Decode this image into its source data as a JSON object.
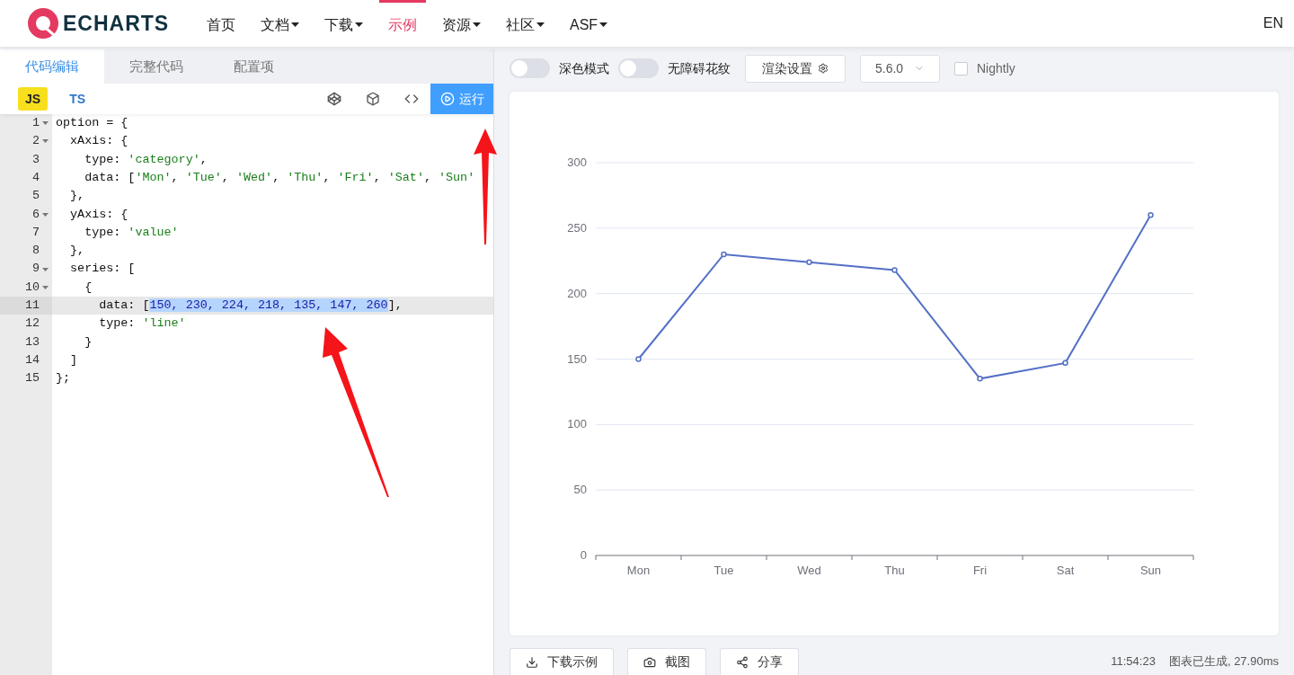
{
  "header": {
    "logo": "ECHARTS",
    "nav": [
      {
        "label": "首页",
        "dropdown": false,
        "selected": false
      },
      {
        "label": "文档",
        "dropdown": true,
        "selected": false
      },
      {
        "label": "下载",
        "dropdown": true,
        "selected": false
      },
      {
        "label": "示例",
        "dropdown": false,
        "selected": true
      },
      {
        "label": "资源",
        "dropdown": true,
        "selected": false
      },
      {
        "label": "社区",
        "dropdown": true,
        "selected": false
      },
      {
        "label": "ASF",
        "dropdown": true,
        "selected": false
      }
    ],
    "language": "EN"
  },
  "editor": {
    "tabs": [
      {
        "label": "代码编辑",
        "selected": true
      },
      {
        "label": "完整代码",
        "selected": false
      },
      {
        "label": "配置项",
        "selected": false
      }
    ],
    "languages": [
      {
        "label": "JS",
        "selected": true
      },
      {
        "label": "TS",
        "selected": false
      }
    ],
    "run_button": "运行",
    "lines": [
      {
        "number": "1",
        "foldable": true,
        "active": false,
        "tokens": [
          {
            "kind": "plain",
            "text": "option = {"
          }
        ]
      },
      {
        "number": "2",
        "foldable": true,
        "active": false,
        "tokens": [
          {
            "kind": "plain",
            "text": "  xAxis: {"
          }
        ]
      },
      {
        "number": "3",
        "foldable": false,
        "active": false,
        "tokens": [
          {
            "kind": "plain",
            "text": "    type: "
          },
          {
            "kind": "string",
            "text": "'category'"
          },
          {
            "kind": "plain",
            "text": ","
          }
        ]
      },
      {
        "number": "4",
        "foldable": false,
        "active": false,
        "tokens": [
          {
            "kind": "plain",
            "text": "    data: ["
          },
          {
            "kind": "string",
            "text": "'Mon'"
          },
          {
            "kind": "plain",
            "text": ", "
          },
          {
            "kind": "string",
            "text": "'Tue'"
          },
          {
            "kind": "plain",
            "text": ", "
          },
          {
            "kind": "string",
            "text": "'Wed'"
          },
          {
            "kind": "plain",
            "text": ", "
          },
          {
            "kind": "string",
            "text": "'Thu'"
          },
          {
            "kind": "plain",
            "text": ", "
          },
          {
            "kind": "string",
            "text": "'Fri'"
          },
          {
            "kind": "plain",
            "text": ", "
          },
          {
            "kind": "string",
            "text": "'Sat'"
          },
          {
            "kind": "plain",
            "text": ", "
          },
          {
            "kind": "string",
            "text": "'Sun'"
          }
        ]
      },
      {
        "number": "5",
        "foldable": false,
        "active": false,
        "tokens": [
          {
            "kind": "plain",
            "text": "  },"
          }
        ]
      },
      {
        "number": "6",
        "foldable": true,
        "active": false,
        "tokens": [
          {
            "kind": "plain",
            "text": "  yAxis: {"
          }
        ]
      },
      {
        "number": "7",
        "foldable": false,
        "active": false,
        "tokens": [
          {
            "kind": "plain",
            "text": "    type: "
          },
          {
            "kind": "string",
            "text": "'value'"
          }
        ]
      },
      {
        "number": "8",
        "foldable": false,
        "active": false,
        "tokens": [
          {
            "kind": "plain",
            "text": "  },"
          }
        ]
      },
      {
        "number": "9",
        "foldable": true,
        "active": false,
        "tokens": [
          {
            "kind": "plain",
            "text": "  series: ["
          }
        ]
      },
      {
        "number": "10",
        "foldable": true,
        "active": false,
        "tokens": [
          {
            "kind": "plain",
            "text": "    {"
          }
        ]
      },
      {
        "number": "11",
        "foldable": false,
        "active": true,
        "tokens": [
          {
            "kind": "plain",
            "text": "      data: ["
          },
          {
            "kind": "number",
            "text": "150, 230, 224, 218, 135, 147, 260",
            "selected": true
          },
          {
            "kind": "plain",
            "text": "],"
          }
        ]
      },
      {
        "number": "12",
        "foldable": false,
        "active": false,
        "tokens": [
          {
            "kind": "plain",
            "text": "      type: "
          },
          {
            "kind": "string",
            "text": "'line'"
          }
        ]
      },
      {
        "number": "13",
        "foldable": false,
        "active": false,
        "tokens": [
          {
            "kind": "plain",
            "text": "    }"
          }
        ]
      },
      {
        "number": "14",
        "foldable": false,
        "active": false,
        "tokens": [
          {
            "kind": "plain",
            "text": "  ]"
          }
        ]
      },
      {
        "number": "15",
        "foldable": false,
        "active": false,
        "tokens": [
          {
            "kind": "plain",
            "text": "};"
          }
        ]
      }
    ]
  },
  "preview": {
    "toggles": [
      {
        "label": "深色模式",
        "on": false
      },
      {
        "label": "无障碍花纹",
        "on": false
      }
    ],
    "render_settings": "渲染设置",
    "version": "5.6.0",
    "nightly": {
      "label": "Nightly",
      "checked": false
    },
    "chart_data": {
      "type": "line",
      "categories": [
        "Mon",
        "Tue",
        "Wed",
        "Thu",
        "Fri",
        "Sat",
        "Sun"
      ],
      "series": [
        {
          "color": "#5470c6",
          "marker": "circle",
          "values": [
            150,
            230,
            224,
            218,
            135,
            147,
            260
          ]
        }
      ],
      "ylim": [
        0,
        300
      ],
      "yticks": [
        0,
        50,
        100,
        150,
        200,
        250,
        300
      ],
      "grid": true
    },
    "actions": [
      {
        "kind": "download",
        "label": "下载示例"
      },
      {
        "kind": "screenshot",
        "label": "截图"
      },
      {
        "kind": "share",
        "label": "分享"
      }
    ],
    "status": {
      "time": "11:54:23",
      "message": "图表已生成, 27.90ms"
    }
  }
}
